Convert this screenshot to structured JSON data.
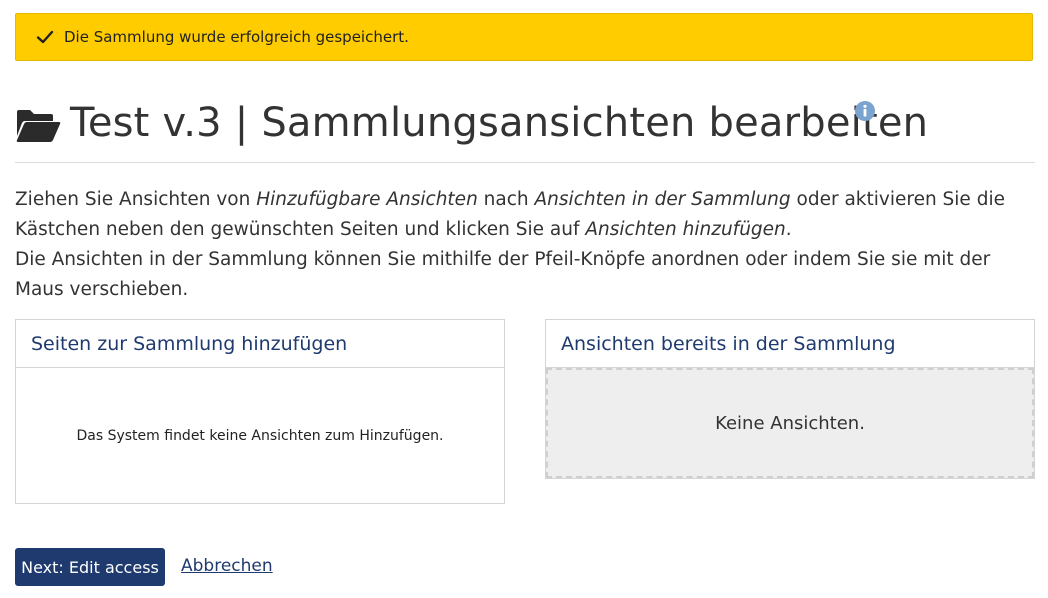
{
  "alert": {
    "message": "Die Sammlung wurde erfolgreich gespeichert."
  },
  "header": {
    "title": "Test v.3 | Sammlungsansichten bearbeiten"
  },
  "description": {
    "line1_a": "Ziehen Sie Ansichten von ",
    "line1_em1": "Hinzufügbare Ansichten",
    "line1_b": " nach ",
    "line1_em2": "Ansichten in der Sammlung",
    "line1_c": " oder aktivieren Sie die Kästchen neben den gewünschten Seiten und klicken Sie auf ",
    "line1_em3": "Ansichten hinzufügen",
    "line1_d": ".",
    "line2": "Die Ansichten in der Sammlung können Sie mithilfe der Pfeil-Knöpfe anordnen oder indem Sie sie mit der Maus verschieben."
  },
  "panels": {
    "add": {
      "heading": "Seiten zur Sammlung hinzufügen",
      "empty": "Das System findet keine Ansichten zum Hinzufügen."
    },
    "existing": {
      "heading": "Ansichten bereits in der Sammlung",
      "empty": "Keine Ansichten."
    }
  },
  "actions": {
    "next_label": "Next: Edit access",
    "cancel_label": "Abbrechen"
  },
  "colors": {
    "alert_bg": "#ffcc00",
    "primary": "#1f3a6e",
    "info_icon": "#7ba3cf"
  }
}
